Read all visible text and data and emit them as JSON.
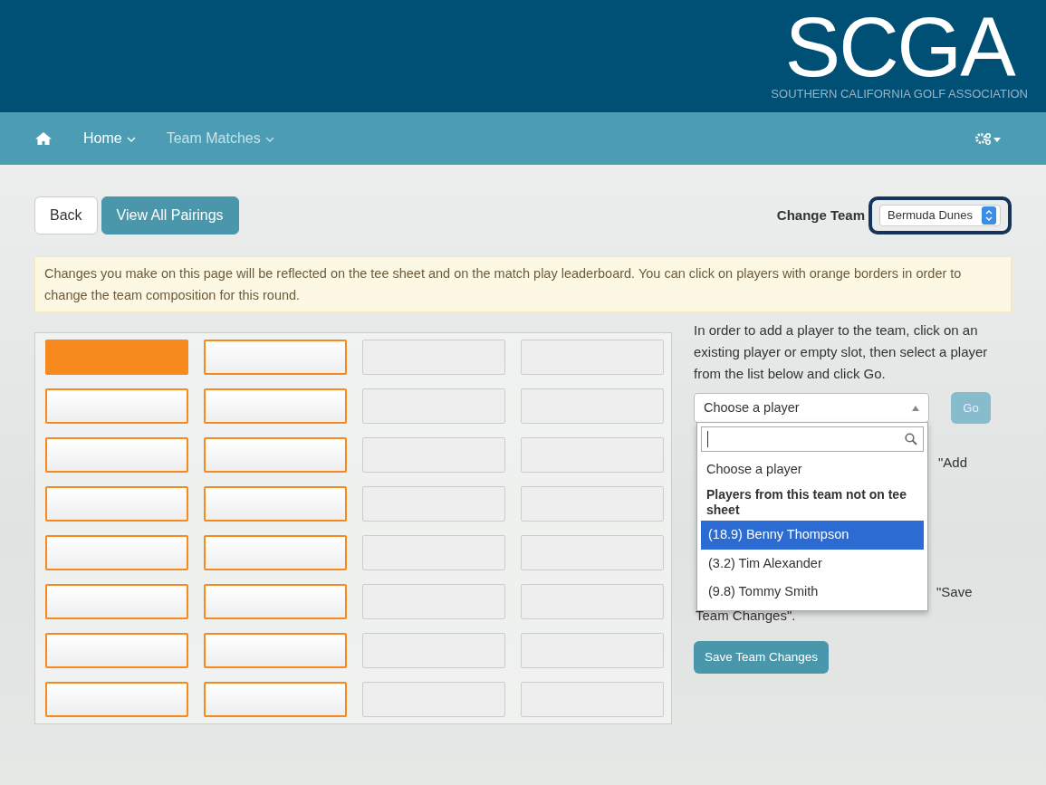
{
  "header": {
    "logo_text": "SCGA",
    "logo_subtitle": "SOUTHERN CALIFORNIA GOLF ASSOCIATION"
  },
  "nav": {
    "items": [
      {
        "label": "Home",
        "selected": true
      },
      {
        "label": "Team Matches",
        "selected": false
      }
    ]
  },
  "buttons": {
    "back": "Back",
    "view_all": "View All Pairings"
  },
  "change_team": {
    "label": "Change Team",
    "value": "Bermuda Dunes"
  },
  "notice": "Changes you make on this page will be reflected on the tee sheet and on the match play leaderboard. You can click on players with orange borders in order to change the team composition for this round.",
  "slots": [
    [
      {
        "editable": true,
        "selected": true
      },
      {
        "editable": true,
        "selected": false
      },
      {
        "editable": false,
        "selected": false
      },
      {
        "editable": false,
        "selected": false
      }
    ],
    [
      {
        "editable": true,
        "selected": false
      },
      {
        "editable": true,
        "selected": false
      },
      {
        "editable": false,
        "selected": false
      },
      {
        "editable": false,
        "selected": false
      }
    ],
    [
      {
        "editable": true,
        "selected": false
      },
      {
        "editable": true,
        "selected": false
      },
      {
        "editable": false,
        "selected": false
      },
      {
        "editable": false,
        "selected": false
      }
    ],
    [
      {
        "editable": true,
        "selected": false
      },
      {
        "editable": true,
        "selected": false
      },
      {
        "editable": false,
        "selected": false
      },
      {
        "editable": false,
        "selected": false
      }
    ],
    [
      {
        "editable": true,
        "selected": false
      },
      {
        "editable": true,
        "selected": false
      },
      {
        "editable": false,
        "selected": false
      },
      {
        "editable": false,
        "selected": false
      }
    ],
    [
      {
        "editable": true,
        "selected": false
      },
      {
        "editable": true,
        "selected": false
      },
      {
        "editable": false,
        "selected": false
      },
      {
        "editable": false,
        "selected": false
      }
    ],
    [
      {
        "editable": true,
        "selected": false
      },
      {
        "editable": true,
        "selected": false
      },
      {
        "editable": false,
        "selected": false
      },
      {
        "editable": false,
        "selected": false
      }
    ],
    [
      {
        "editable": true,
        "selected": false
      },
      {
        "editable": true,
        "selected": false
      },
      {
        "editable": false,
        "selected": false
      },
      {
        "editable": false,
        "selected": false
      }
    ]
  ],
  "instructions": "In order to add a player to the team, click on an existing player or empty slot, then select a player from the list below and click Go.",
  "player_select": {
    "value": "Choose a player",
    "expanded": true,
    "options": [
      {
        "kind": "option",
        "label": "Choose a player",
        "highlighted": false
      },
      {
        "kind": "group",
        "label": "Players from this team not on tee sheet"
      },
      {
        "kind": "option",
        "label": "(18.9) Benny Thompson",
        "highlighted": true
      },
      {
        "kind": "option",
        "label": "(3.2) Tim Alexander",
        "highlighted": false
      },
      {
        "kind": "option",
        "label": "(9.8) Tommy Smith",
        "highlighted": false
      }
    ]
  },
  "go_button": "Go",
  "hidden_text": [
    "\"Add",
    "\"Save",
    "Team Changes\"."
  ],
  "save_button": "Save Team Changes"
}
